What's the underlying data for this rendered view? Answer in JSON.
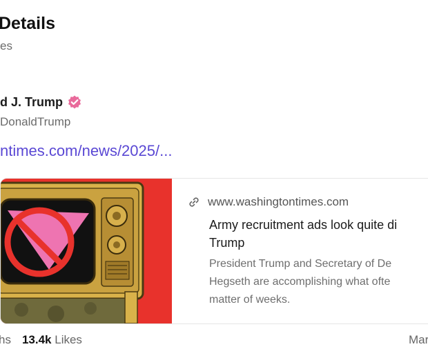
{
  "header": {
    "title": "Details",
    "subtitle": "es"
  },
  "author": {
    "name": "d J. Trump",
    "handle": "DonaldTrump",
    "verified_color": "#e96a9b"
  },
  "post": {
    "link_text": "ntimes.com/news/2025/..."
  },
  "card": {
    "domain": "www.washingtontimes.com",
    "title_lines": [
      "Army recruitment ads look quite di",
      "Trump"
    ],
    "desc_lines": [
      "President Trump and Secretary of De",
      "Hegseth are accomplishing what ofte",
      "matter of weeks."
    ]
  },
  "stats": {
    "left_label": "hs",
    "likes_count": "13.4k",
    "likes_label": "Likes",
    "right_label": "Mar"
  },
  "colors": {
    "accent": "#5a48d4",
    "image_bg": "#e8322c"
  }
}
